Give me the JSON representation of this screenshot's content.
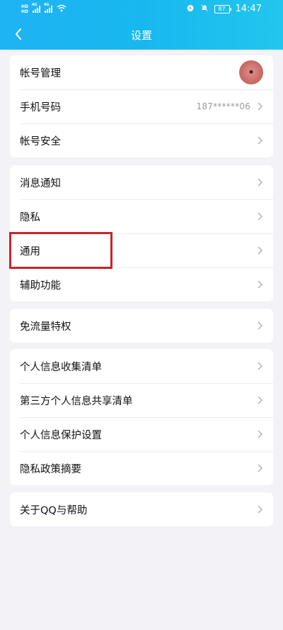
{
  "status_bar": {
    "net1_top": "HD",
    "net1_bot": "HD",
    "signal1_label": "4G",
    "signal2_label": "4G",
    "battery": "87",
    "time": "14:47"
  },
  "header": {
    "title": "设置"
  },
  "groups": [
    {
      "items": [
        {
          "label": "帐号管理",
          "value": "",
          "avatar": true
        },
        {
          "label": "手机号码",
          "value": "187******06"
        },
        {
          "label": "帐号安全",
          "value": ""
        }
      ]
    },
    {
      "items": [
        {
          "label": "消息通知"
        },
        {
          "label": "隐私"
        },
        {
          "label": "通用"
        },
        {
          "label": "辅助功能"
        }
      ]
    },
    {
      "items": [
        {
          "label": "免流量特权"
        }
      ]
    },
    {
      "items": [
        {
          "label": "个人信息收集清单"
        },
        {
          "label": "第三方个人信息共享清单"
        },
        {
          "label": "个人信息保护设置"
        },
        {
          "label": "隐私政策摘要"
        }
      ]
    },
    {
      "items": [
        {
          "label": "关于QQ与帮助"
        }
      ]
    }
  ],
  "colors": {
    "header": "#1fb3f5",
    "highlight": "#c8252b",
    "background": "#f2f2f7"
  }
}
